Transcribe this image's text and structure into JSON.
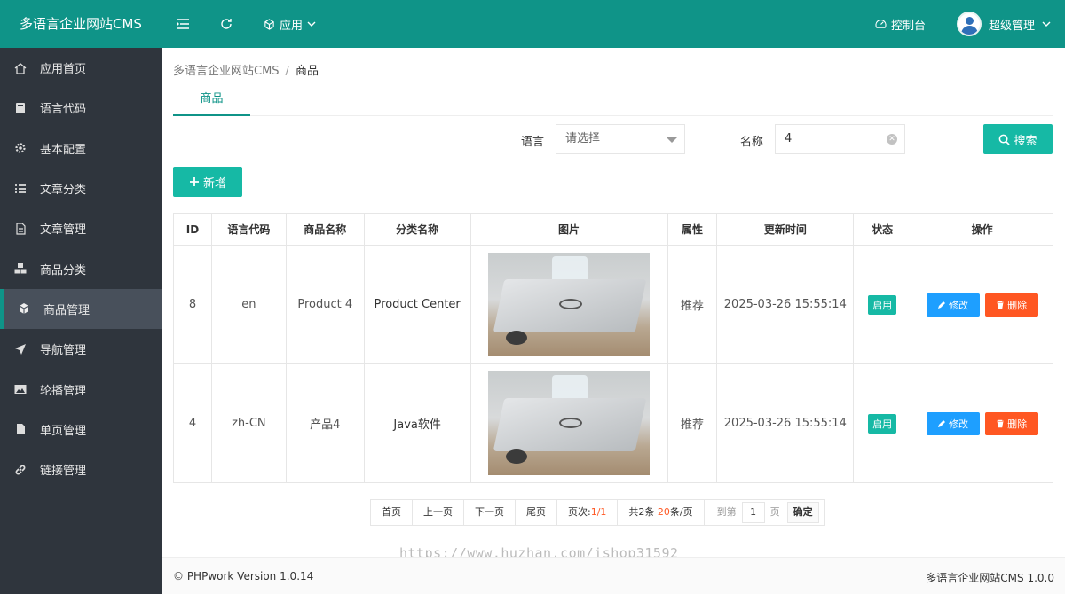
{
  "app": {
    "brand": "多语言企业网站CMS"
  },
  "header": {
    "menu_label": "应用",
    "console_label": "控制台",
    "user_label": "超级管理"
  },
  "sidebar": {
    "items": [
      {
        "label": "应用首页",
        "icon": "home-icon"
      },
      {
        "label": "语言代码",
        "icon": "book-icon"
      },
      {
        "label": "基本配置",
        "icon": "gear-icon"
      },
      {
        "label": "文章分类",
        "icon": "list-icon"
      },
      {
        "label": "文章管理",
        "icon": "document-icon"
      },
      {
        "label": "商品分类",
        "icon": "cubes-icon"
      },
      {
        "label": "商品管理",
        "icon": "cube-icon",
        "active": true
      },
      {
        "label": "导航管理",
        "icon": "location-arrow-icon"
      },
      {
        "label": "轮播管理",
        "icon": "image-icon"
      },
      {
        "label": "单页管理",
        "icon": "file-icon"
      },
      {
        "label": "链接管理",
        "icon": "link-icon"
      }
    ]
  },
  "breadcrumb": {
    "root": "多语言企业网站CMS",
    "separator": "/",
    "current": "商品"
  },
  "tabs": [
    {
      "label": "商品",
      "active": true
    }
  ],
  "filters": {
    "language_label": "语言",
    "language_placeholder": "请选择",
    "name_label": "名称",
    "name_value": "4",
    "search_label": "搜索"
  },
  "toolbar": {
    "add_label": "新增"
  },
  "table": {
    "columns": [
      "ID",
      "语言代码",
      "商品名称",
      "分类名称",
      "图片",
      "属性",
      "更新时间",
      "状态",
      "操作"
    ],
    "rows": [
      {
        "id": "8",
        "lang": "en",
        "name": "Product 4",
        "category": "Product Center",
        "attr": "推荐",
        "updated": "2025-03-26 15:55:14",
        "status": "启用",
        "edit": "修改",
        "delete": "删除"
      },
      {
        "id": "4",
        "lang": "zh-CN",
        "name": "产品4",
        "category": "Java软件",
        "attr": "推荐",
        "updated": "2025-03-26 15:55:14",
        "status": "启用",
        "edit": "修改",
        "delete": "删除"
      }
    ]
  },
  "pager": {
    "first": "首页",
    "prev": "上一页",
    "next": "下一页",
    "last": "尾页",
    "page_prefix": "页次:",
    "page_value": "1/1",
    "total_prefix": "共2条 ",
    "per_page": "20",
    "per_page_suffix": "条/页",
    "goto_label": "到第",
    "goto_value": "1",
    "page_unit": "页",
    "confirm": "确定"
  },
  "watermark": "https://www.huzhan.com/ishop31592",
  "footer": {
    "left": "© PHPwork Version 1.0.14",
    "right": "多语言企业网站CMS 1.0.0"
  },
  "colors": {
    "primary": "#0f9488",
    "accent": "#16b9a5",
    "sidebar": "#2f353d",
    "edit": "#1e9fff",
    "delete": "#ff5722"
  }
}
